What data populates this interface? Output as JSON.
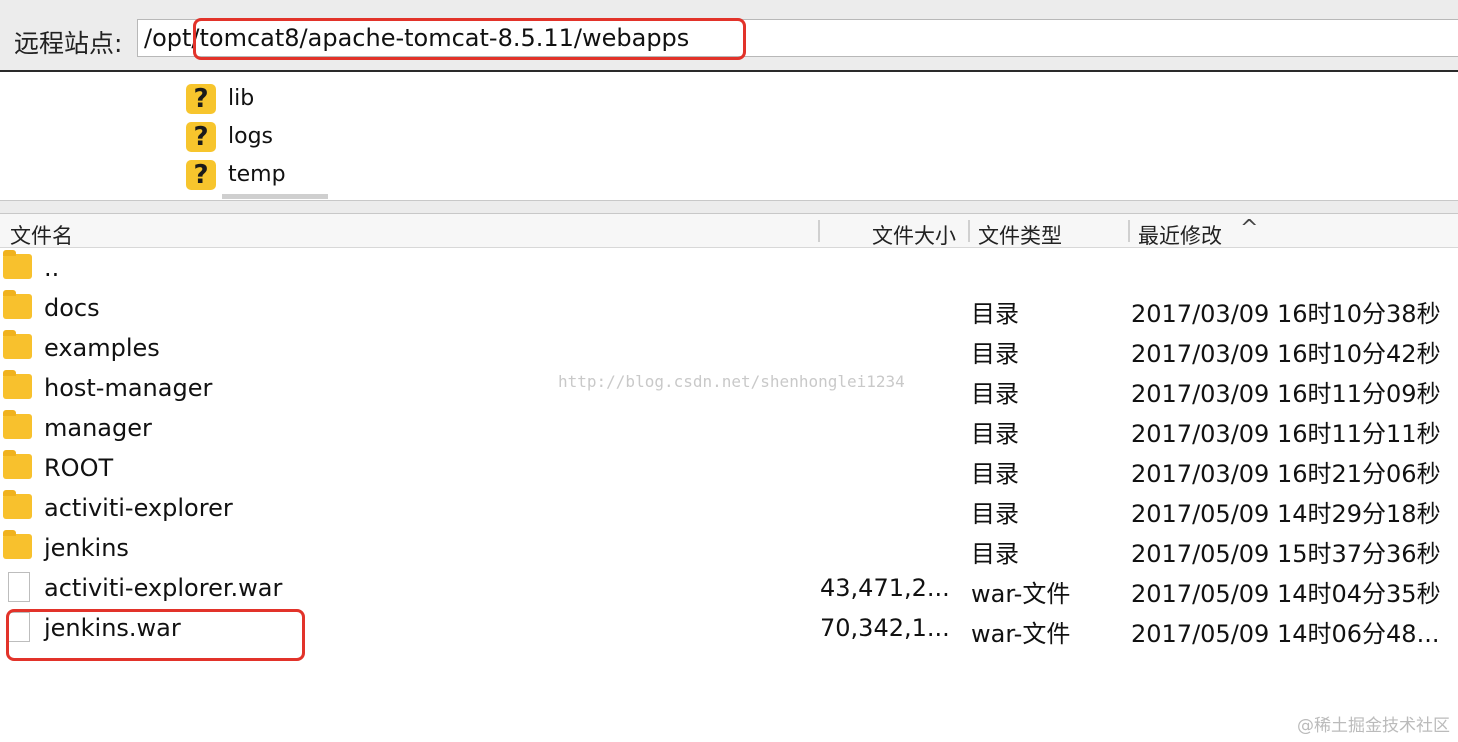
{
  "remote_site": {
    "label": "远程站点:",
    "path": "/opt/tomcat8/apache-tomcat-8.5.11/webapps"
  },
  "tree": {
    "items": [
      {
        "label": "lib",
        "icon": "unknown-folder-icon"
      },
      {
        "label": "logs",
        "icon": "unknown-folder-icon"
      },
      {
        "label": "temp",
        "icon": "unknown-folder-icon"
      }
    ]
  },
  "columns": {
    "name": "文件名",
    "size": "文件大小",
    "type": "文件类型",
    "modified": "最近修改",
    "sort_indicator": "^"
  },
  "files": [
    {
      "name": "..",
      "size": "",
      "type": "",
      "modified": "",
      "icon": "folder-icon"
    },
    {
      "name": "docs",
      "size": "",
      "type": "目录",
      "modified": "2017/03/09 16时10分38秒",
      "icon": "folder-icon"
    },
    {
      "name": "examples",
      "size": "",
      "type": "目录",
      "modified": "2017/03/09 16时10分42秒",
      "icon": "folder-icon"
    },
    {
      "name": "host-manager",
      "size": "",
      "type": "目录",
      "modified": "2017/03/09 16时11分09秒",
      "icon": "folder-icon"
    },
    {
      "name": "manager",
      "size": "",
      "type": "目录",
      "modified": "2017/03/09 16时11分11秒",
      "icon": "folder-icon"
    },
    {
      "name": "ROOT",
      "size": "",
      "type": "目录",
      "modified": "2017/03/09 16时21分06秒",
      "icon": "folder-icon"
    },
    {
      "name": "activiti-explorer",
      "size": "",
      "type": "目录",
      "modified": "2017/05/09 14时29分18秒",
      "icon": "folder-icon"
    },
    {
      "name": "jenkins",
      "size": "",
      "type": "目录",
      "modified": "2017/05/09 15时37分36秒",
      "icon": "folder-icon"
    },
    {
      "name": "activiti-explorer.war",
      "size": "43,471,2...",
      "type": "war-文件",
      "modified": "2017/05/09 14时04分35秒",
      "icon": "file-icon"
    },
    {
      "name": "jenkins.war",
      "size": "70,342,1...",
      "type": "war-文件",
      "modified": "2017/05/09 14时06分48...",
      "icon": "file-icon"
    }
  ],
  "watermark": "http://blog.csdn.net/shenhonglei1234",
  "corner_mark": "@稀土掘金技术社区",
  "colors": {
    "highlight": "#e2332a",
    "folder": "#f8c12d"
  }
}
